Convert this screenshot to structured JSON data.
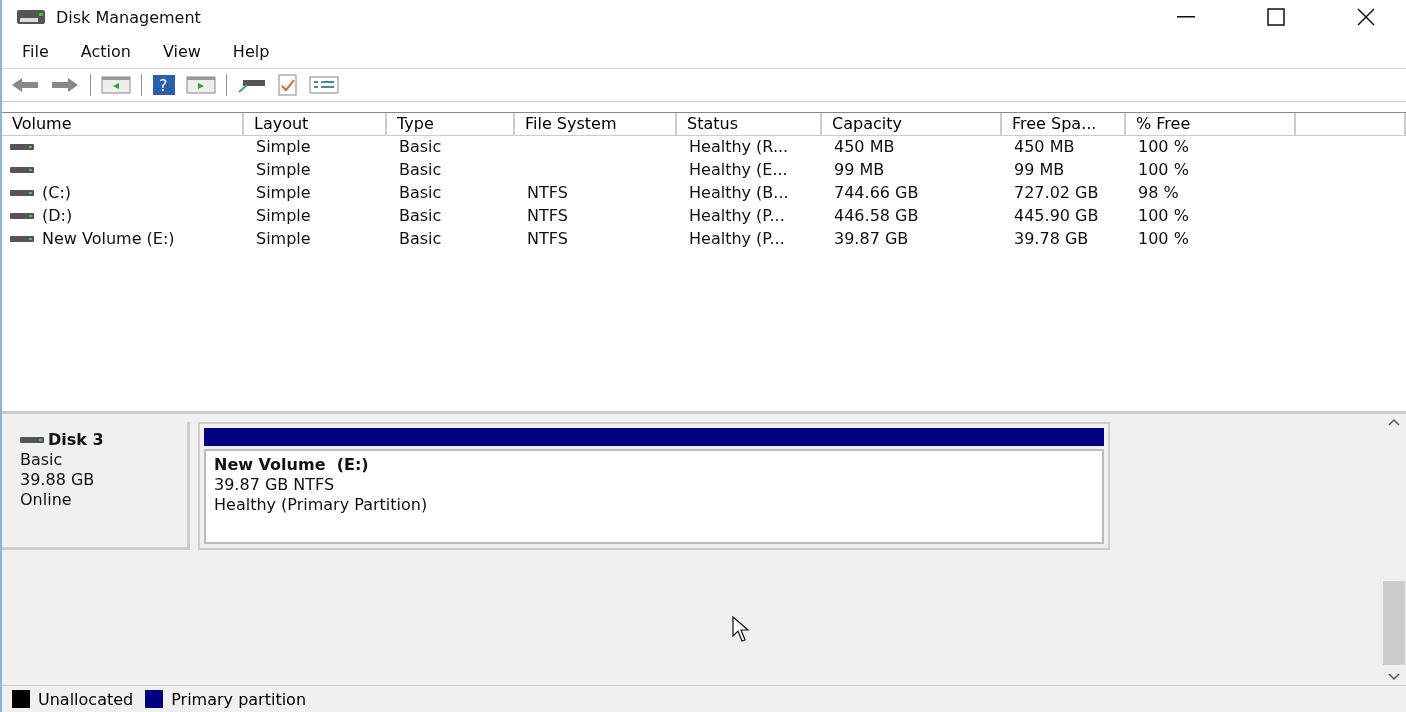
{
  "window": {
    "title": "Disk Management"
  },
  "menu": [
    "File",
    "Action",
    "View",
    "Help"
  ],
  "toolbar": {
    "help_glyph": "?"
  },
  "table": {
    "columns": [
      "Volume",
      "Layout",
      "Type",
      "File System",
      "Status",
      "Capacity",
      "Free Spa...",
      "% Free"
    ],
    "rows": [
      {
        "volume": "",
        "layout": "Simple",
        "type": "Basic",
        "file_system": "",
        "status": "Healthy (R...",
        "capacity": "450 MB",
        "free_space": "450 MB",
        "percent_free": "100 %"
      },
      {
        "volume": "",
        "layout": "Simple",
        "type": "Basic",
        "file_system": "",
        "status": "Healthy (E...",
        "capacity": "99 MB",
        "free_space": "99 MB",
        "percent_free": "100 %"
      },
      {
        "volume": "(C:)",
        "layout": "Simple",
        "type": "Basic",
        "file_system": "NTFS",
        "status": "Healthy (B...",
        "capacity": "744.66 GB",
        "free_space": "727.02 GB",
        "percent_free": "98 %"
      },
      {
        "volume": "(D:)",
        "layout": "Simple",
        "type": "Basic",
        "file_system": "NTFS",
        "status": "Healthy (P...",
        "capacity": "446.58 GB",
        "free_space": "445.90 GB",
        "percent_free": "100 %"
      },
      {
        "volume": "New Volume (E:)",
        "layout": "Simple",
        "type": "Basic",
        "file_system": "NTFS",
        "status": "Healthy (P...",
        "capacity": "39.87 GB",
        "free_space": "39.78 GB",
        "percent_free": "100 %"
      }
    ]
  },
  "disk": {
    "name": "Disk 3",
    "type": "Basic",
    "size": "39.88 GB",
    "state": "Online",
    "partition": {
      "name": "New Volume  (E:)",
      "size_fs": "39.87 GB NTFS",
      "status": "Healthy (Primary Partition)",
      "color": "#000080"
    }
  },
  "legend": [
    {
      "label": "Unallocated",
      "color": "#000000"
    },
    {
      "label": "Primary partition",
      "color": "#000080"
    }
  ]
}
